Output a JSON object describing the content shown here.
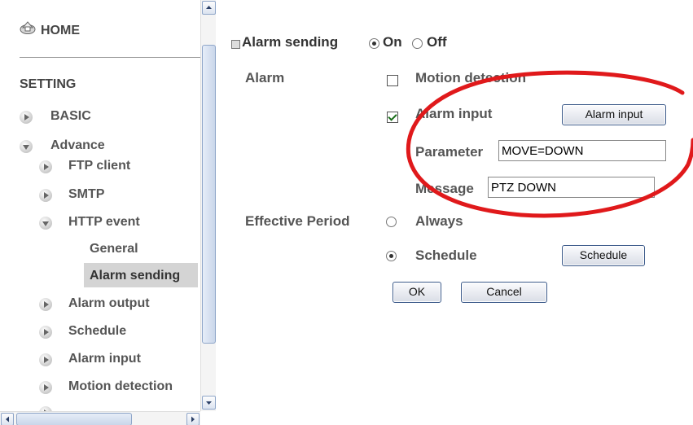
{
  "nav": {
    "home_label": "HOME",
    "setting_label": "SETTING",
    "items": [
      {
        "label": "BASIC",
        "expanded": false
      },
      {
        "label": "Advance",
        "expanded": true
      },
      {
        "label": "FTP client",
        "expanded": false
      },
      {
        "label": "SMTP",
        "expanded": false
      },
      {
        "label": "HTTP event",
        "expanded": true
      },
      {
        "label": "General"
      },
      {
        "label": "Alarm sending",
        "selected": true
      },
      {
        "label": "Alarm output",
        "expanded": false
      },
      {
        "label": "Schedule",
        "expanded": false
      },
      {
        "label": "Alarm input",
        "expanded": false
      },
      {
        "label": "Motion detection",
        "expanded": false
      }
    ]
  },
  "form": {
    "section_label": "Alarm sending",
    "on_label": "On",
    "off_label": "Off",
    "alarm_sending_value": "On",
    "alarm_label": "Alarm",
    "motion_detection_label": "Motion detection",
    "motion_detection_checked": false,
    "alarm_input_label": "Alarm input",
    "alarm_input_checked": true,
    "alarm_input_button": "Alarm input",
    "parameter_label": "Parameter",
    "parameter_value": "MOVE=DOWN",
    "message_label": "Message",
    "message_value": "PTZ DOWN",
    "effective_period_label": "Effective Period",
    "always_label": "Always",
    "schedule_label": "Schedule",
    "effective_period_value": "Schedule",
    "schedule_button": "Schedule",
    "ok_button": "OK",
    "cancel_button": "Cancel"
  },
  "colors": {
    "annotation": "#e0191b",
    "selected_nav_bg": "#d4d4d4",
    "button_border": "#3c5a8a"
  },
  "icons": {
    "home": "home-icon",
    "nav_bullet": "triangle-bullet-icon",
    "scroll_up": "arrow-up-icon",
    "scroll_down": "arrow-down-icon"
  }
}
